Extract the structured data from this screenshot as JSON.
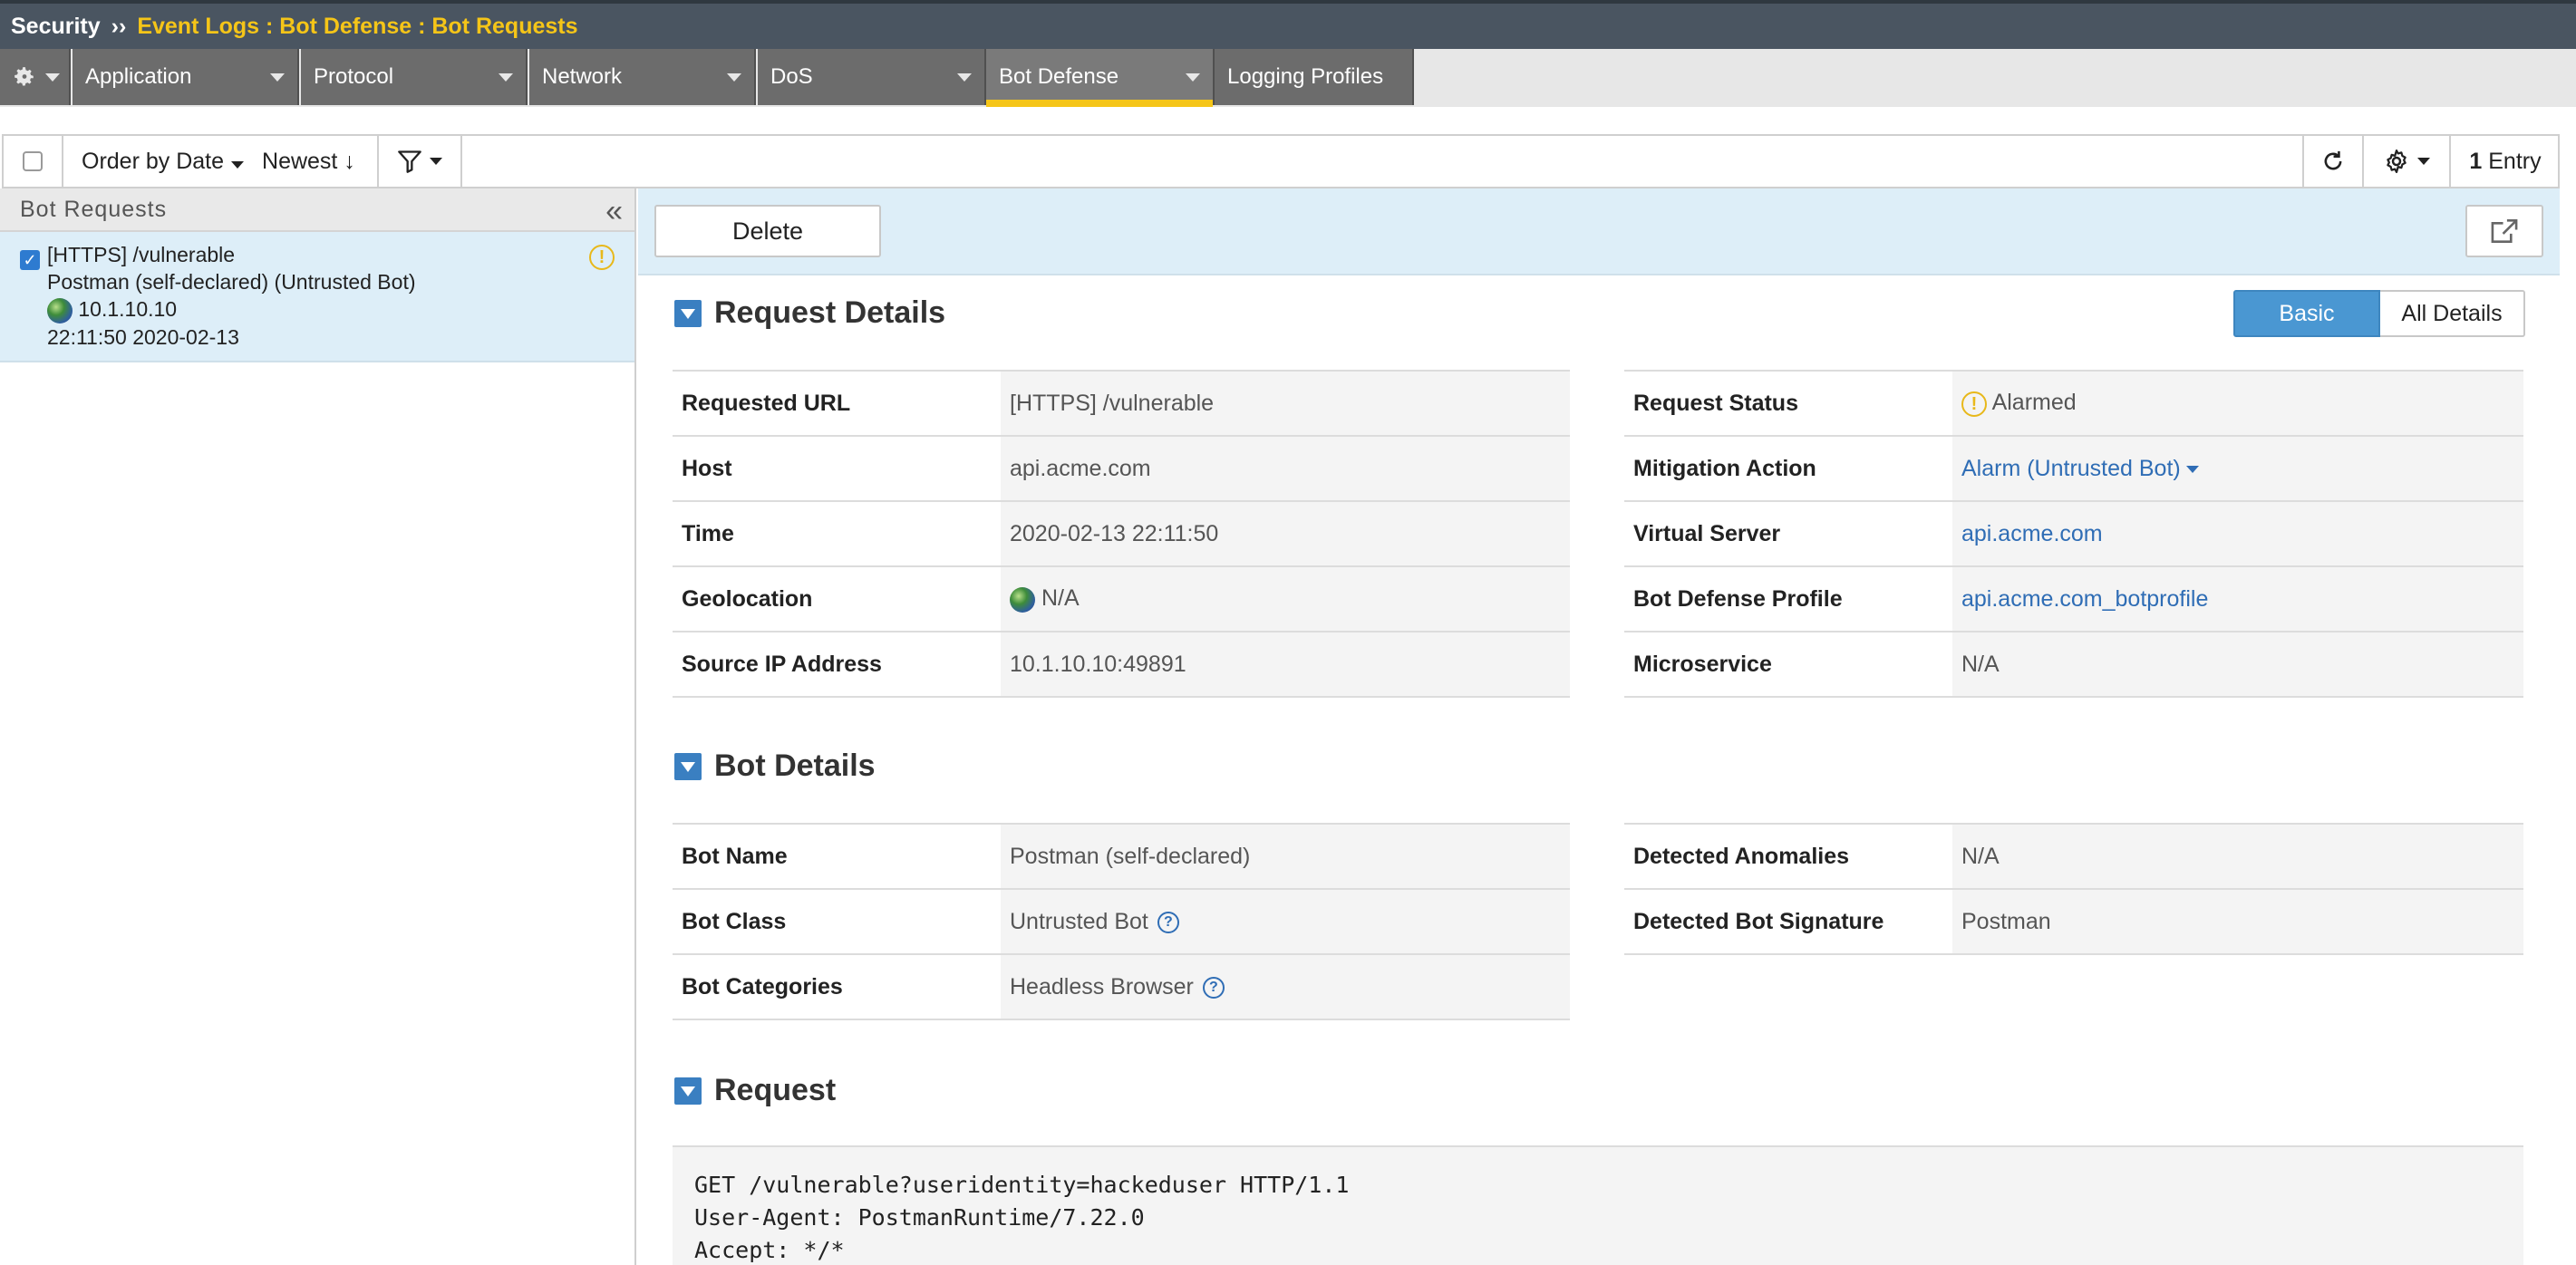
{
  "titlebar": {
    "root": "Security",
    "separator": "››",
    "crumb": "Event Logs : Bot Defense : Bot Requests"
  },
  "menubar": {
    "items": [
      {
        "label": "Application"
      },
      {
        "label": "Protocol"
      },
      {
        "label": "Network"
      },
      {
        "label": "DoS"
      },
      {
        "label": "Bot Defense"
      },
      {
        "label": "Logging Profiles"
      }
    ],
    "active": "Bot Defense"
  },
  "toolbar": {
    "order_label": "Order by Date",
    "sort_label": "Newest ↓",
    "entry_count": "1",
    "entry_label": "Entry"
  },
  "left_panel": {
    "title": "Bot Requests",
    "collapse": "«",
    "items": [
      {
        "checked": true,
        "line1": "[HTTPS] /vulnerable",
        "line2": "Postman (self-declared) (Untrusted Bot)",
        "ip": "10.1.10.10",
        "time": "22:11:50 2020-02-13",
        "status_icon": "warning-icon"
      }
    ]
  },
  "actions": {
    "delete_label": "Delete"
  },
  "view_toggle": {
    "basic": "Basic",
    "all": "All Details"
  },
  "request_details": {
    "title": "Request Details",
    "left": [
      {
        "key": "Requested URL",
        "value": "[HTTPS] /vulnerable"
      },
      {
        "key": "Host",
        "value": "api.acme.com"
      },
      {
        "key": "Time",
        "value": "2020-02-13 22:11:50"
      },
      {
        "key": "Geolocation",
        "value": "N/A"
      },
      {
        "key": "Source IP Address",
        "value": "10.1.10.10:49891"
      }
    ],
    "right": [
      {
        "key": "Request Status",
        "value": "Alarmed"
      },
      {
        "key": "Mitigation Action",
        "value": "Alarm (Untrusted Bot)"
      },
      {
        "key": "Virtual Server",
        "value": "api.acme.com"
      },
      {
        "key": "Bot Defense Profile",
        "value": "api.acme.com_botprofile"
      },
      {
        "key": "Microservice",
        "value": "N/A"
      }
    ]
  },
  "bot_details": {
    "title": "Bot Details",
    "left": [
      {
        "key": "Bot Name",
        "value": "Postman (self-declared)"
      },
      {
        "key": "Bot Class",
        "value": "Untrusted Bot"
      },
      {
        "key": "Bot Categories",
        "value": "Headless Browser"
      }
    ],
    "right": [
      {
        "key": "Detected Anomalies",
        "value": "N/A"
      },
      {
        "key": "Detected Bot Signature",
        "value": "Postman"
      }
    ]
  },
  "request": {
    "title": "Request",
    "lines": [
      "GET /vulnerable?useridentity=hackeduser HTTP/1.1",
      "User-Agent: PostmanRuntime/7.22.0",
      "Accept: */*"
    ]
  },
  "colors": {
    "accent": "#f5c518",
    "link": "#2f6db5",
    "selected_bg": "#ddeef8",
    "toggle_on": "#4a97d2"
  }
}
